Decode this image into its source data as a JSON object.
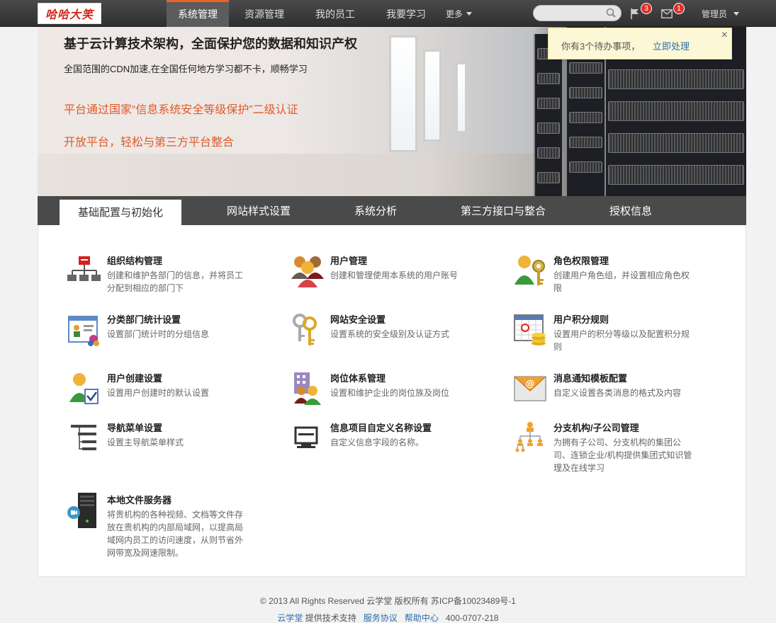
{
  "logo": {
    "text": "哈哈大笑"
  },
  "nav": {
    "items": [
      {
        "label": "系统管理"
      },
      {
        "label": "资源管理"
      },
      {
        "label": "我的员工"
      },
      {
        "label": "我要学习"
      }
    ],
    "more_label": "更多"
  },
  "search": {
    "placeholder": ""
  },
  "notifications": {
    "flag_count": "3",
    "mail_count": "1"
  },
  "user": {
    "name": "管理员"
  },
  "toast": {
    "message": "你有3个待办事项，",
    "action": "立即处理",
    "close": "×"
  },
  "hero": {
    "title": "基于云计算技术架构，全面保护您的数据和知识产权",
    "subtitle": "全国范围的CDN加速,在全国任何地方学习都不卡，顺畅学习",
    "line1": "平台通过国家“信息系统安全等级保护”二级认证",
    "line2": "开放平台，轻松与第三方平台整合"
  },
  "tabs": [
    {
      "label": "基础配置与初始化"
    },
    {
      "label": "网站样式设置"
    },
    {
      "label": "系统分析"
    },
    {
      "label": "第三方接口与整合"
    },
    {
      "label": "授权信息"
    }
  ],
  "items": [
    {
      "title": "组织结构管理",
      "desc": "创建和维护各部门的信息，并将员工分配到相应的部门下",
      "icon": "org-chart-icon"
    },
    {
      "title": "用户管理",
      "desc": "创建和管理使用本系统的用户账号",
      "icon": "users-icon"
    },
    {
      "title": "角色权限管理",
      "desc": "创建用户角色组，并设置相应角色权限",
      "icon": "user-key-icon"
    },
    {
      "title": "分类部门统计设置",
      "desc": "设置部门统计时的分组信息",
      "icon": "stats-window-icon"
    },
    {
      "title": "网站安全设置",
      "desc": "设置系统的安全级别及认证方式",
      "icon": "keys-icon"
    },
    {
      "title": "用户积分规则",
      "desc": "设置用户的积分等级以及配置积分规则",
      "icon": "calendar-coins-icon"
    },
    {
      "title": "用户创建设置",
      "desc": "设置用户创建时的默认设置",
      "icon": "user-check-icon"
    },
    {
      "title": "岗位体系管理",
      "desc": "设置和维护企业的岗位族及岗位",
      "icon": "team-building-icon"
    },
    {
      "title": "消息通知模板配置",
      "desc": "自定义设置各类消息的格式及内容",
      "icon": "mail-at-icon"
    },
    {
      "title": "导航菜单设置",
      "desc": "设置主导航菜单样式",
      "icon": "menu-list-icon"
    },
    {
      "title": "信息项目自定义名称设置",
      "desc": "自定义信息字段的名称。",
      "icon": "monitor-icon"
    },
    {
      "title": "分支机构/子公司管理",
      "desc": "为拥有子公司、分支机构的集团公司、连锁企业/机构提供集团式知识管理及在线学习",
      "icon": "branch-org-icon"
    },
    {
      "title": "本地文件服务器",
      "desc": "将贵机构的各种视频、文档等文件存放在贵机构的内部局域网，以提高局域网内员工的访问速度，从则节省外网带宽及网速限制。",
      "icon": "file-server-icon"
    }
  ],
  "footer": {
    "line1": "© 2013 All Rights Reserved  云学堂 版权所有  苏ICP备10023489号-1",
    "provider": "云学堂",
    "provider_suffix": "提供技术支持",
    "terms": "服务协议",
    "help": "帮助中心",
    "phone": "400-0707-218"
  }
}
